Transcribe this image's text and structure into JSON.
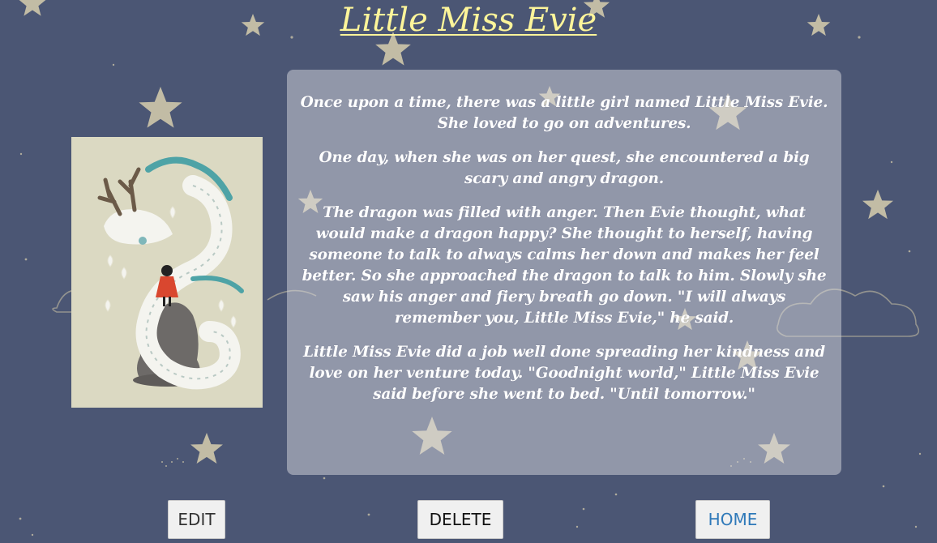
{
  "page": {
    "title": "Little Miss Evie"
  },
  "story": {
    "paragraphs": [
      "Once upon a time, there was a little girl named Little Miss Evie. She loved to go on adventures.",
      "One day, when she was on her quest, she encountered a big scary and angry dragon.",
      "The dragon was filled with anger. Then Evie thought, what would make a dragon happy? She thought to herself, having someone to talk to always calms her down and makes her feel better. So she approached the dragon to talk to him. Slowly she saw his anger and fiery breath go down. \"I will always remember you, Little Miss Evie,\" he said.",
      "Little Miss Evie did a job well done spreading her kindness and love on her venture today. \"Goodnight world,\" Little Miss Evie said before she went to bed. \"Until tomorrow.\""
    ]
  },
  "buttons": {
    "edit": "EDIT",
    "delete": "DELETE",
    "home": "HOME"
  },
  "colors": {
    "background": "#4b5674",
    "title": "#fdf59a",
    "story_text": "#ffffff",
    "home_link": "#2f79b9"
  },
  "illustration": {
    "subject": "white dragon coiled around a rock with a girl in a red cloak"
  }
}
